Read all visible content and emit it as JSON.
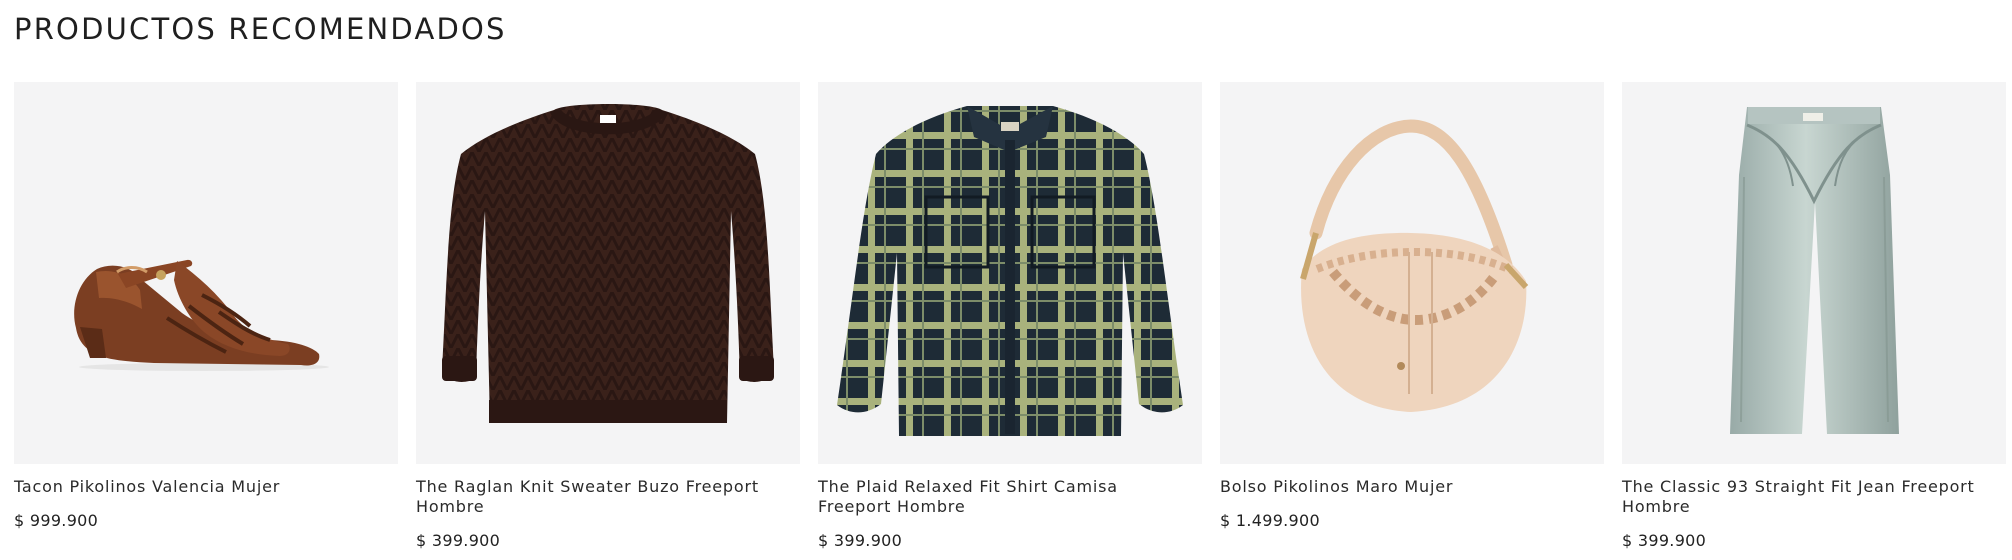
{
  "section": {
    "title": "PRODUCTOS RECOMENDADOS"
  },
  "products": [
    {
      "name": "Tacon Pikolinos Valencia Mujer",
      "price": "$ 999.900",
      "icon": "sandal-product-image"
    },
    {
      "name": "The Raglan Knit Sweater Buzo Freeport Hombre",
      "price": "$ 399.900",
      "icon": "sweater-product-image"
    },
    {
      "name": "The Plaid Relaxed Fit Shirt Camisa Freeport Hombre",
      "price": "$ 399.900",
      "icon": "plaid-shirt-product-image"
    },
    {
      "name": "Bolso Pikolinos Maro Mujer",
      "price": "$ 1.499.900",
      "icon": "handbag-product-image"
    },
    {
      "name": "The Classic 93 Straight Fit Jean Freeport Hombre",
      "price": "$ 399.900",
      "icon": "jeans-product-image"
    }
  ]
}
